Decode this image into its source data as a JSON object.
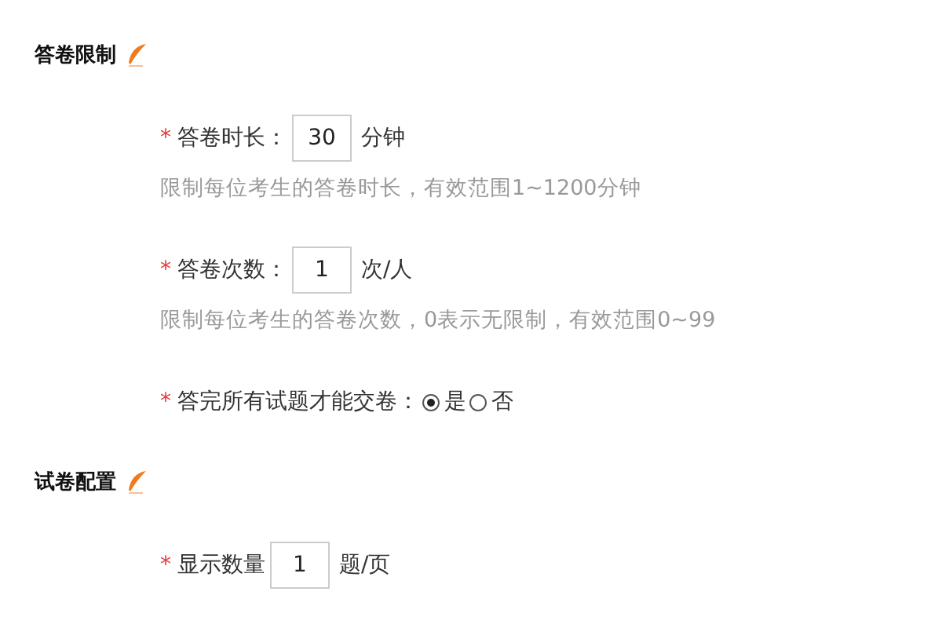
{
  "sections": [
    {
      "title": "答卷限制",
      "fields": [
        {
          "kind": "input",
          "marker": "*",
          "label": "答卷时长：",
          "value": "30",
          "unit": "分钟",
          "hint": "限制每位考生的答卷时长，有效范围1~1200分钟"
        },
        {
          "kind": "input",
          "marker": "*",
          "label": "答卷次数：",
          "value": "1",
          "unit": "次/人",
          "hint": "限制每位考生的答卷次数，0表示无限制，有效范围0~99"
        },
        {
          "kind": "radio",
          "marker": "*",
          "label": "答完所有试题才能交卷：",
          "options": [
            {
              "label": "是",
              "selected": true
            },
            {
              "label": "否",
              "selected": false
            }
          ]
        }
      ]
    },
    {
      "title": "试卷配置",
      "fields": [
        {
          "kind": "input",
          "marker": "*",
          "label": "显示数量",
          "value": "1",
          "unit": "题/页"
        }
      ]
    }
  ]
}
